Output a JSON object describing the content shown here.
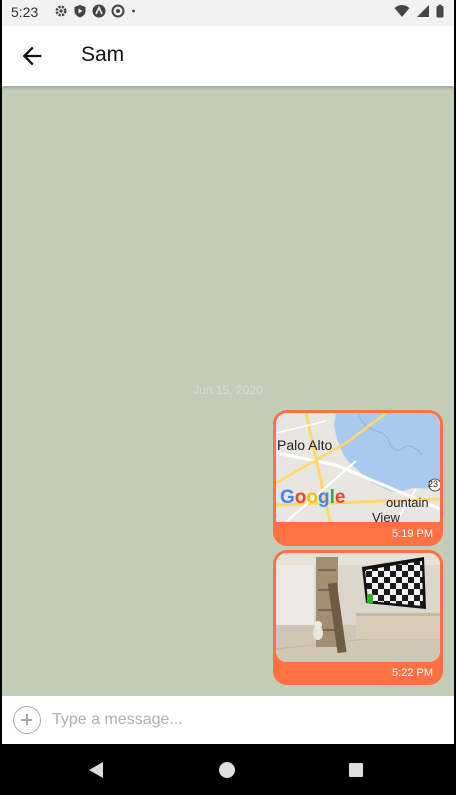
{
  "status_bar": {
    "time": "5:23",
    "left_icons": [
      "settings-icon",
      "shield-play-icon",
      "autoplay-icon",
      "sync-icon",
      "dot-icon"
    ],
    "right_icons": [
      "wifi-icon",
      "signal-icon",
      "battery-icon"
    ]
  },
  "app_bar": {
    "back_icon": "arrow-back-icon",
    "title": "Sam"
  },
  "chat": {
    "background_color": "#c1cdb6",
    "date_separator": "Jun 15, 2020",
    "bubble_color": "#ff7043",
    "messages": [
      {
        "type": "location",
        "map_labels": [
          "Palo Alto",
          "ountain",
          "View",
          "23"
        ],
        "time": "5:19 PM"
      },
      {
        "type": "image",
        "time": "5:22 PM"
      }
    ]
  },
  "input": {
    "add_icon": "add-circle-icon",
    "placeholder": "Type a message..."
  },
  "nav_bar": {
    "icons": [
      "back-triangle-icon",
      "home-circle-icon",
      "recents-square-icon"
    ]
  }
}
